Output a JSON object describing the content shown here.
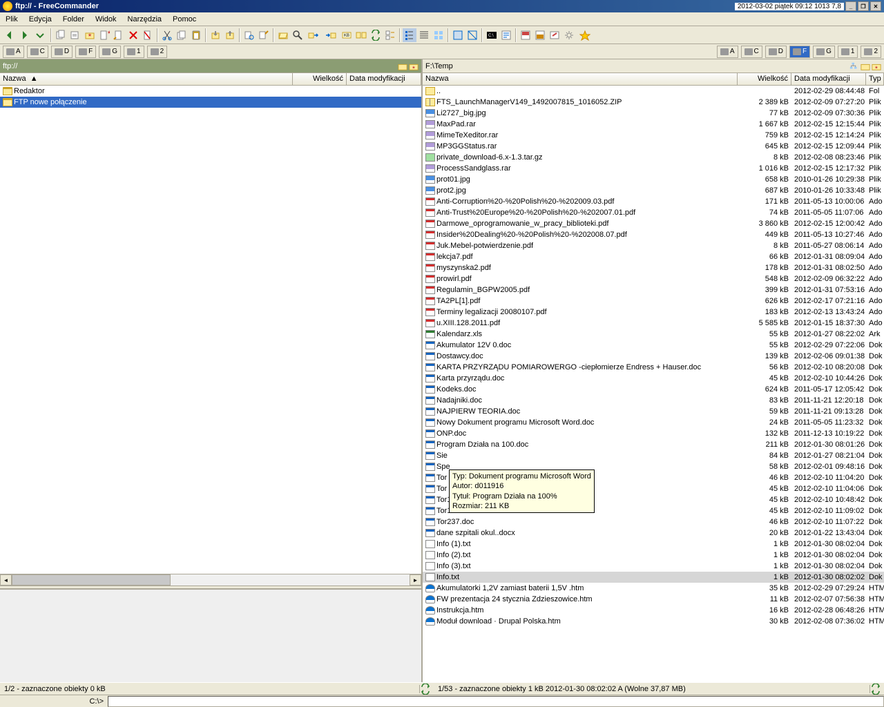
{
  "title": "ftp:// - FreeCommander",
  "taskbar_info": "2012-03-02 piątek 09:12  1013  7,8",
  "menu": [
    "Plik",
    "Edycja",
    "Folder",
    "Widok",
    "Narzędzia",
    "Pomoc"
  ],
  "drives_left": [
    {
      "label": "A",
      "id": "a"
    },
    {
      "label": "C",
      "id": "c"
    },
    {
      "label": "D",
      "id": "d"
    },
    {
      "label": "F",
      "id": "f"
    },
    {
      "label": "G",
      "id": "g"
    },
    {
      "label": "1",
      "id": "n1"
    },
    {
      "label": "2",
      "id": "n2"
    }
  ],
  "drives_right": [
    {
      "label": "A",
      "id": "a"
    },
    {
      "label": "C",
      "id": "c"
    },
    {
      "label": "D",
      "id": "d"
    },
    {
      "label": "F",
      "id": "f",
      "active": true
    },
    {
      "label": "G",
      "id": "g"
    },
    {
      "label": "1",
      "id": "n1"
    },
    {
      "label": "2",
      "id": "n2"
    }
  ],
  "path_left": "ftp://",
  "path_right": "F:\\Temp",
  "cols": {
    "name": "Nazwa",
    "size": "Wielkość",
    "date": "Data modyfikacji",
    "type": "Typ"
  },
  "left_sort_arrow": "▲",
  "left_rows": [
    {
      "kind": "folder",
      "name": "Redaktor"
    },
    {
      "kind": "folder",
      "name": "FTP nowe połączenie",
      "selected": true
    }
  ],
  "highlight_index": 45,
  "right_rows": [
    {
      "kind": "up",
      "name": "..",
      "size": "",
      "date": "2012-02-29 08:44:48",
      "type": "Fol"
    },
    {
      "kind": "zip",
      "name": "FTS_LaunchManagerV149_1492007815_1016052.ZIP",
      "size": "2 389 kB",
      "date": "2012-02-09 07:27:20",
      "type": "Plik"
    },
    {
      "kind": "jpg",
      "name": "Li2727_big.jpg",
      "size": "77 kB",
      "date": "2012-02-09 07:30:36",
      "type": "Plik"
    },
    {
      "kind": "rar",
      "name": "MaxPad.rar",
      "size": "1 667 kB",
      "date": "2012-02-15 12:15:44",
      "type": "Plik"
    },
    {
      "kind": "rar",
      "name": "MimeTeXeditor.rar",
      "size": "759 kB",
      "date": "2012-02-15 12:14:24",
      "type": "Plik"
    },
    {
      "kind": "rar",
      "name": "MP3GGStatus.rar",
      "size": "645 kB",
      "date": "2012-02-15 12:09:44",
      "type": "Plik"
    },
    {
      "kind": "gz",
      "name": "private_download-6.x-1.3.tar.gz",
      "size": "8 kB",
      "date": "2012-02-08 08:23:46",
      "type": "Plik"
    },
    {
      "kind": "rar",
      "name": "ProcessSandglass.rar",
      "size": "1 016 kB",
      "date": "2012-02-15 12:17:32",
      "type": "Plik"
    },
    {
      "kind": "jpg",
      "name": "prot01.jpg",
      "size": "658 kB",
      "date": "2010-01-26 10:29:38",
      "type": "Plik"
    },
    {
      "kind": "jpg",
      "name": "prot2.jpg",
      "size": "687 kB",
      "date": "2010-01-26 10:33:48",
      "type": "Plik"
    },
    {
      "kind": "pdf",
      "name": "Anti-Corruption%20-%20Polish%20-%202009.03.pdf",
      "size": "171 kB",
      "date": "2011-05-13 10:00:06",
      "type": "Ado"
    },
    {
      "kind": "pdf",
      "name": "Anti-Trust%20Europe%20-%20Polish%20-%202007.01.pdf",
      "size": "74 kB",
      "date": "2011-05-05 11:07:06",
      "type": "Ado"
    },
    {
      "kind": "pdf",
      "name": "Darmowe_oprogramowanie_w_pracy_biblioteki.pdf",
      "size": "3 860 kB",
      "date": "2012-02-15 12:00:42",
      "type": "Ado"
    },
    {
      "kind": "pdf",
      "name": "Insider%20Dealing%20-%20Polish%20-%202008.07.pdf",
      "size": "449 kB",
      "date": "2011-05-13 10:27:46",
      "type": "Ado"
    },
    {
      "kind": "pdf",
      "name": "Juk.Mebel-potwierdzenie.pdf",
      "size": "8 kB",
      "date": "2011-05-27 08:06:14",
      "type": "Ado"
    },
    {
      "kind": "pdf",
      "name": "lekcja7.pdf",
      "size": "66 kB",
      "date": "2012-01-31 08:09:04",
      "type": "Ado"
    },
    {
      "kind": "pdf",
      "name": "myszynska2.pdf",
      "size": "178 kB",
      "date": "2012-01-31 08:02:50",
      "type": "Ado"
    },
    {
      "kind": "pdf",
      "name": "prowirl.pdf",
      "size": "548 kB",
      "date": "2012-02-09 06:32:22",
      "type": "Ado"
    },
    {
      "kind": "pdf",
      "name": "Regulamin_BGPW2005.pdf",
      "size": "399 kB",
      "date": "2012-01-31 07:53:16",
      "type": "Ado"
    },
    {
      "kind": "pdf",
      "name": "TA2PL[1].pdf",
      "size": "626 kB",
      "date": "2012-02-17 07:21:16",
      "type": "Ado"
    },
    {
      "kind": "pdf",
      "name": "Terminy legalizacji 20080107.pdf",
      "size": "183 kB",
      "date": "2012-02-13 13:43:24",
      "type": "Ado"
    },
    {
      "kind": "pdf",
      "name": "u.XIII.128.2011.pdf",
      "size": "5 585 kB",
      "date": "2012-01-15 18:37:30",
      "type": "Ado"
    },
    {
      "kind": "xls",
      "name": "Kalendarz.xls",
      "size": "55 kB",
      "date": "2012-01-27 08:22:02",
      "type": "Ark"
    },
    {
      "kind": "doc",
      "name": "Akumulator 12V 0.doc",
      "size": "55 kB",
      "date": "2012-02-29 07:22:06",
      "type": "Dok"
    },
    {
      "kind": "doc",
      "name": "Dostawcy.doc",
      "size": "139 kB",
      "date": "2012-02-06 09:01:38",
      "type": "Dok"
    },
    {
      "kind": "doc",
      "name": "KARTA PRZYRZĄDU POMIAROWERGO -ciepłomierze Endress + Hauser.doc",
      "size": "56 kB",
      "date": "2012-02-10 08:20:08",
      "type": "Dok"
    },
    {
      "kind": "doc",
      "name": "Karta przyrządu.doc",
      "size": "45 kB",
      "date": "2012-02-10 10:44:26",
      "type": "Dok"
    },
    {
      "kind": "doc",
      "name": "Kodeks.doc",
      "size": "624 kB",
      "date": "2011-05-17 12:05:42",
      "type": "Dok"
    },
    {
      "kind": "doc",
      "name": "Nadajniki.doc",
      "size": "83 kB",
      "date": "2011-11-21 12:20:18",
      "type": "Dok"
    },
    {
      "kind": "doc",
      "name": "NAJPIERW TEORIA.doc",
      "size": "59 kB",
      "date": "2011-11-21 09:13:28",
      "type": "Dok"
    },
    {
      "kind": "doc",
      "name": "Nowy Dokument programu Microsoft Word.doc",
      "size": "24 kB",
      "date": "2011-05-05 11:23:32",
      "type": "Dok"
    },
    {
      "kind": "doc",
      "name": "ONP.doc",
      "size": "132 kB",
      "date": "2011-12-13 10:19:22",
      "type": "Dok"
    },
    {
      "kind": "doc",
      "name": "Program Działa na 100.doc",
      "size": "211 kB",
      "date": "2012-01-30 08:01:26",
      "type": "Dok"
    },
    {
      "kind": "doc",
      "name": "Sie",
      "size": "84 kB",
      "date": "2012-01-27 08:21:04",
      "type": "Dok"
    },
    {
      "kind": "doc",
      "name": "Spe",
      "size": "58 kB",
      "date": "2012-02-01 09:48:16",
      "type": "Dok"
    },
    {
      "kind": "doc",
      "name": "Tor",
      "size": "46 kB",
      "date": "2012-02-10 11:04:20",
      "type": "Dok"
    },
    {
      "kind": "doc",
      "name": "Tor",
      "size": "45 kB",
      "date": "2012-02-10 11:04:06",
      "type": "Dok"
    },
    {
      "kind": "doc",
      "name": "Tor126.doc",
      "size": "45 kB",
      "date": "2012-02-10 10:48:42",
      "type": "Dok"
    },
    {
      "kind": "doc",
      "name": "Tor154.doc",
      "size": "45 kB",
      "date": "2012-02-10 11:09:02",
      "type": "Dok"
    },
    {
      "kind": "doc",
      "name": "Tor237.doc",
      "size": "46 kB",
      "date": "2012-02-10 11:07:22",
      "type": "Dok"
    },
    {
      "kind": "docx",
      "name": "dane szpitali okul..docx",
      "size": "20 kB",
      "date": "2012-01-22 13:43:04",
      "type": "Dok"
    },
    {
      "kind": "txt",
      "name": "Info (1).txt",
      "size": "1 kB",
      "date": "2012-01-30 08:02:04",
      "type": "Dok"
    },
    {
      "kind": "txt",
      "name": "Info (2).txt",
      "size": "1 kB",
      "date": "2012-01-30 08:02:04",
      "type": "Dok"
    },
    {
      "kind": "txt",
      "name": "Info (3).txt",
      "size": "1 kB",
      "date": "2012-01-30 08:02:04",
      "type": "Dok"
    },
    {
      "kind": "txt",
      "name": "Info.txt",
      "size": "1 kB",
      "date": "2012-01-30 08:02:02",
      "type": "Dok"
    },
    {
      "kind": "htm",
      "name": "Akumulatorki 1,2V zamiast baterii 1,5V  .htm",
      "size": "35 kB",
      "date": "2012-02-29 07:29:24",
      "type": "HTM"
    },
    {
      "kind": "htm",
      "name": "FW prezentacja 24 stycznia Zdzieszowice.htm",
      "size": "11 kB",
      "date": "2012-02-07 07:56:38",
      "type": "HTM"
    },
    {
      "kind": "htm",
      "name": "Instrukcja.htm",
      "size": "16 kB",
      "date": "2012-02-28 06:48:26",
      "type": "HTM"
    },
    {
      "kind": "htm",
      "name": "Moduł download · Drupal Polska.htm",
      "size": "30 kB",
      "date": "2012-02-08 07:36:02",
      "type": "HTM"
    }
  ],
  "tooltip": {
    "line1": "Typ: Dokument programu Microsoft Word",
    "line2": "Autor: d011916",
    "line3": "Tytuł: Program Działa na 100%",
    "line4": "Rozmiar: 211 KB"
  },
  "status_left": "1/2 - zaznaczone obiekty   0 kB",
  "status_right": "1/53 - zaznaczone obiekty   1 kB  2012-01-30 08:02:02  A   (Wolne 37,87 MB)",
  "cmd_label": "C:\\>"
}
